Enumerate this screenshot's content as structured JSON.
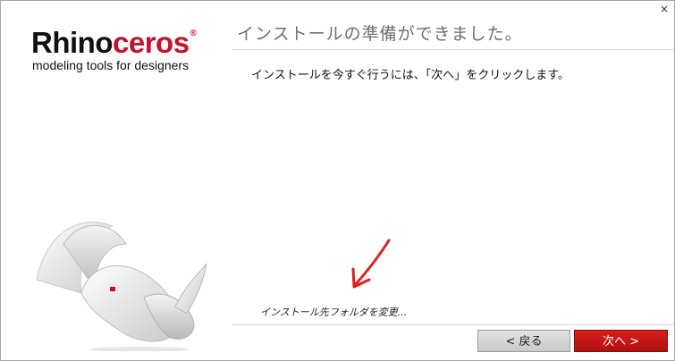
{
  "window": {
    "close_label": "×"
  },
  "logo": {
    "brand_black": "Rhino",
    "brand_red": "ceros",
    "registered": "®",
    "tagline": "modeling tools for designers"
  },
  "header": {
    "title": "インストールの準備ができました。"
  },
  "content": {
    "message": "インストールを今すぐ行うには、「次へ」をクリックします。",
    "change_folder_link": "インストール先フォルダを変更..."
  },
  "buttons": {
    "back_label": "< 戻る",
    "next_label": "次へ >"
  },
  "colors": {
    "brand_red": "#c8102e",
    "next_button": "#c51616",
    "annotation_arrow": "#e02020"
  },
  "icons": {
    "close": "close-icon",
    "logo_art": "rhino-logo",
    "annotation": "red-arrow-icon"
  }
}
